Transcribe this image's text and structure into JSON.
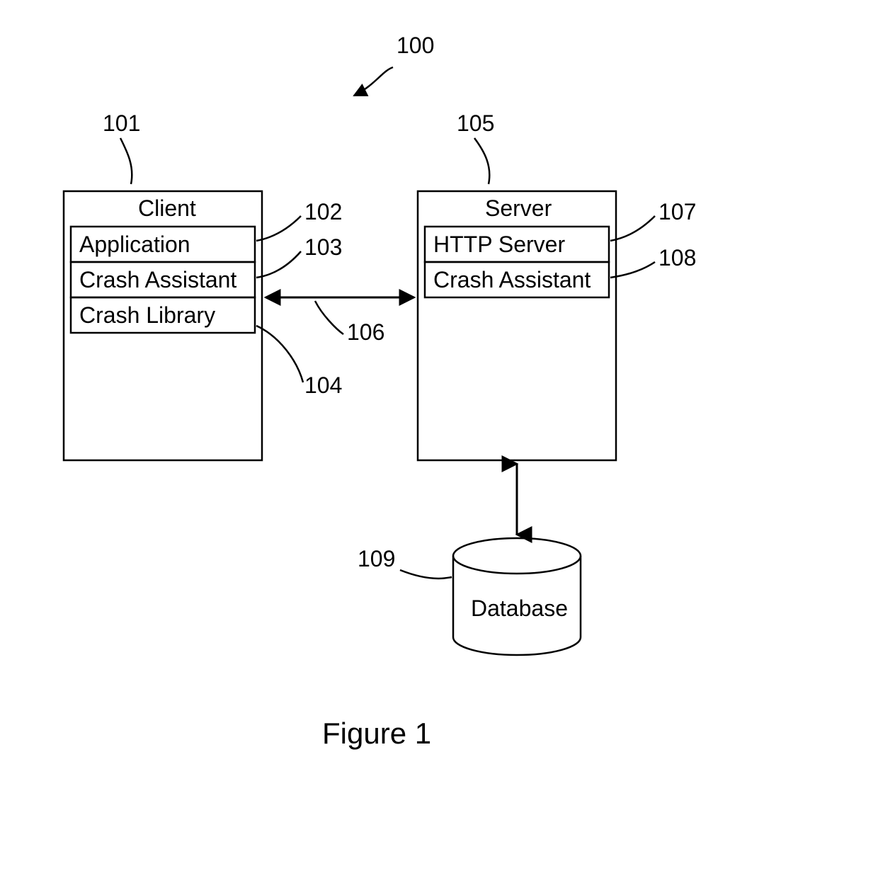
{
  "figure_title": "Figure 1",
  "refs": {
    "system": "100",
    "client": "101",
    "application": "102",
    "client_crash_assistant": "103",
    "crash_library": "104",
    "server": "105",
    "link": "106",
    "http_server": "107",
    "server_crash_assistant": "108",
    "database": "109"
  },
  "labels": {
    "client": "Client",
    "application": "Application",
    "client_crash_assistant": "Crash Assistant",
    "crash_library": "Crash Library",
    "server": "Server",
    "http_server": "HTTP Server",
    "server_crash_assistant": "Crash Assistant",
    "database": "Database"
  }
}
